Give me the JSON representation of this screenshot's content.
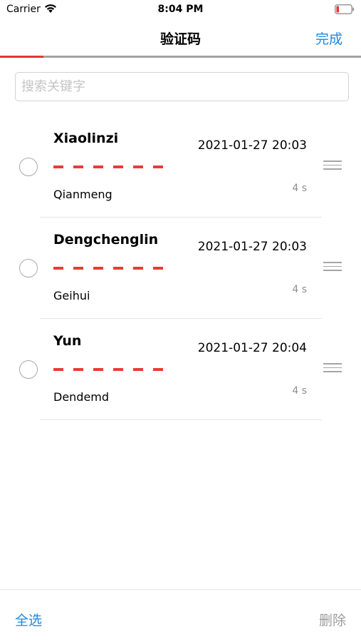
{
  "status_bar": {
    "carrier": "Carrier",
    "time": "8:04 PM"
  },
  "nav": {
    "title": "验证码",
    "done_label": "完成"
  },
  "progress": {
    "fraction": 0.12,
    "color": "#e8323a"
  },
  "search": {
    "placeholder": "搜索关键字",
    "value": ""
  },
  "items": [
    {
      "name": "Xiaolinzi",
      "time": "2021-01-27 20:03",
      "sub": "Qianmeng",
      "count": "4 s"
    },
    {
      "name": "Dengchenglin",
      "time": "2021-01-27 20:03",
      "sub": "Geihui",
      "count": "4 s"
    },
    {
      "name": "Yun",
      "time": "2021-01-27 20:04",
      "sub": "Dendemd",
      "count": "4 s"
    }
  ],
  "toolbar": {
    "select_all_label": "全选",
    "delete_label": "删除"
  },
  "colors": {
    "accent": "#1f87e0",
    "code_dash": "#ea3b32",
    "disabled": "#9b9b9b"
  }
}
